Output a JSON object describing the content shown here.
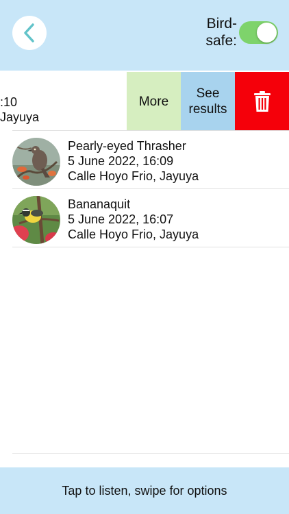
{
  "header": {
    "back_icon": "chevron-left-icon",
    "toggle_label_line1": "Bird-",
    "toggle_label_line2": "safe:",
    "toggle_on": true,
    "toggle_color": "#7ed36b"
  },
  "swiped_row": {
    "time_fragment": ":10",
    "location_fragment": "Jayuya",
    "actions": {
      "more_label": "More",
      "see_results_line1": "See",
      "see_results_line2": "results",
      "delete_icon": "trash-icon"
    },
    "colors": {
      "more": "#d6eec0",
      "see_results": "#a8d3ee",
      "delete": "#f5000a"
    }
  },
  "recordings": [
    {
      "bird": "Pearly-eyed Thrasher",
      "date": "5 June 2022, 16:09",
      "location": "Calle Hoyo Frio, Jayuya",
      "avatar_icon": "thrasher-photo"
    },
    {
      "bird": "Bananaquit",
      "date": "5 June 2022, 16:07",
      "location": "Calle Hoyo Frio, Jayuya",
      "avatar_icon": "bananaquit-photo"
    }
  ],
  "footer": {
    "hint": "Tap to listen, swipe for options"
  }
}
